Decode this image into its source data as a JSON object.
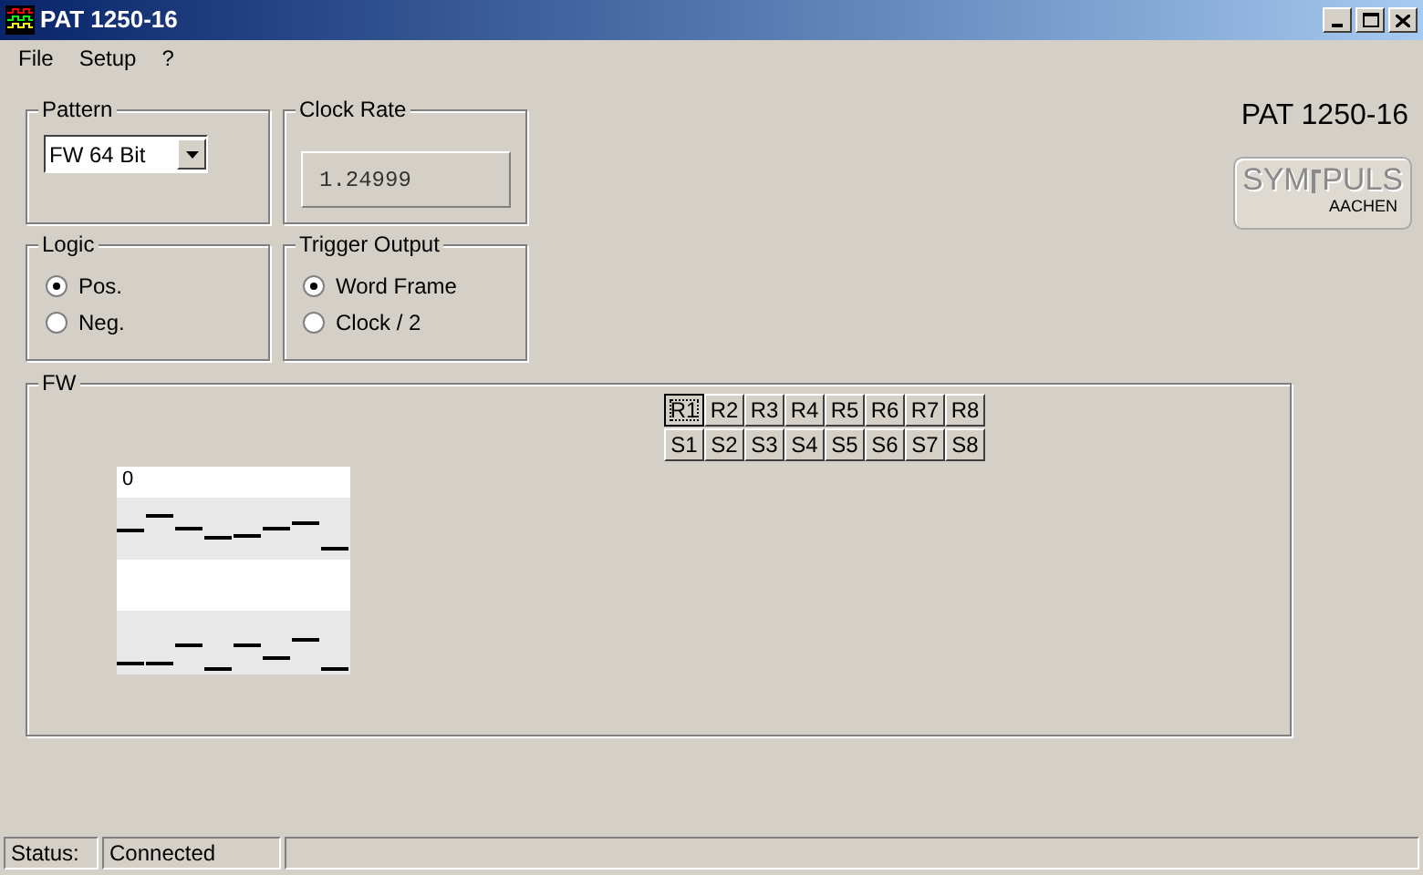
{
  "window": {
    "title": "PAT 1250-16"
  },
  "menu": [
    "File",
    "Setup",
    "?"
  ],
  "pattern": {
    "label": "Pattern",
    "value": "FW 64 Bit"
  },
  "clock_rate": {
    "label": "Clock Rate",
    "value": "1.24999"
  },
  "logic": {
    "label": "Logic",
    "options": [
      {
        "label": "Pos.",
        "selected": true
      },
      {
        "label": "Neg.",
        "selected": false
      }
    ]
  },
  "trigger_output": {
    "label": "Trigger Output",
    "options": [
      {
        "label": "Word Frame",
        "selected": true
      },
      {
        "label": "Clock / 2",
        "selected": false
      }
    ]
  },
  "device_name": "PAT 1250-16",
  "logo": {
    "top": "SYM",
    "top2": "PULS",
    "bottom": "AACHEN"
  },
  "fw": {
    "label": "FW",
    "buttons_r": [
      {
        "label": "R1",
        "selected": true
      },
      {
        "label": "R2",
        "selected": false
      },
      {
        "label": "R3",
        "selected": false
      },
      {
        "label": "R4",
        "selected": false
      },
      {
        "label": "R5",
        "selected": false
      },
      {
        "label": "R6",
        "selected": false
      },
      {
        "label": "R7",
        "selected": false
      },
      {
        "label": "R8",
        "selected": false
      }
    ],
    "buttons_s": [
      {
        "label": "S1",
        "selected": false
      },
      {
        "label": "S2",
        "selected": false
      },
      {
        "label": "S3",
        "selected": false
      },
      {
        "label": "S4",
        "selected": false
      },
      {
        "label": "S5",
        "selected": false
      },
      {
        "label": "S6",
        "selected": false
      },
      {
        "label": "S7",
        "selected": false
      },
      {
        "label": "S8",
        "selected": false
      }
    ],
    "plot_label": "0"
  },
  "status_bar": {
    "label": "Status:",
    "value": "Connected"
  }
}
